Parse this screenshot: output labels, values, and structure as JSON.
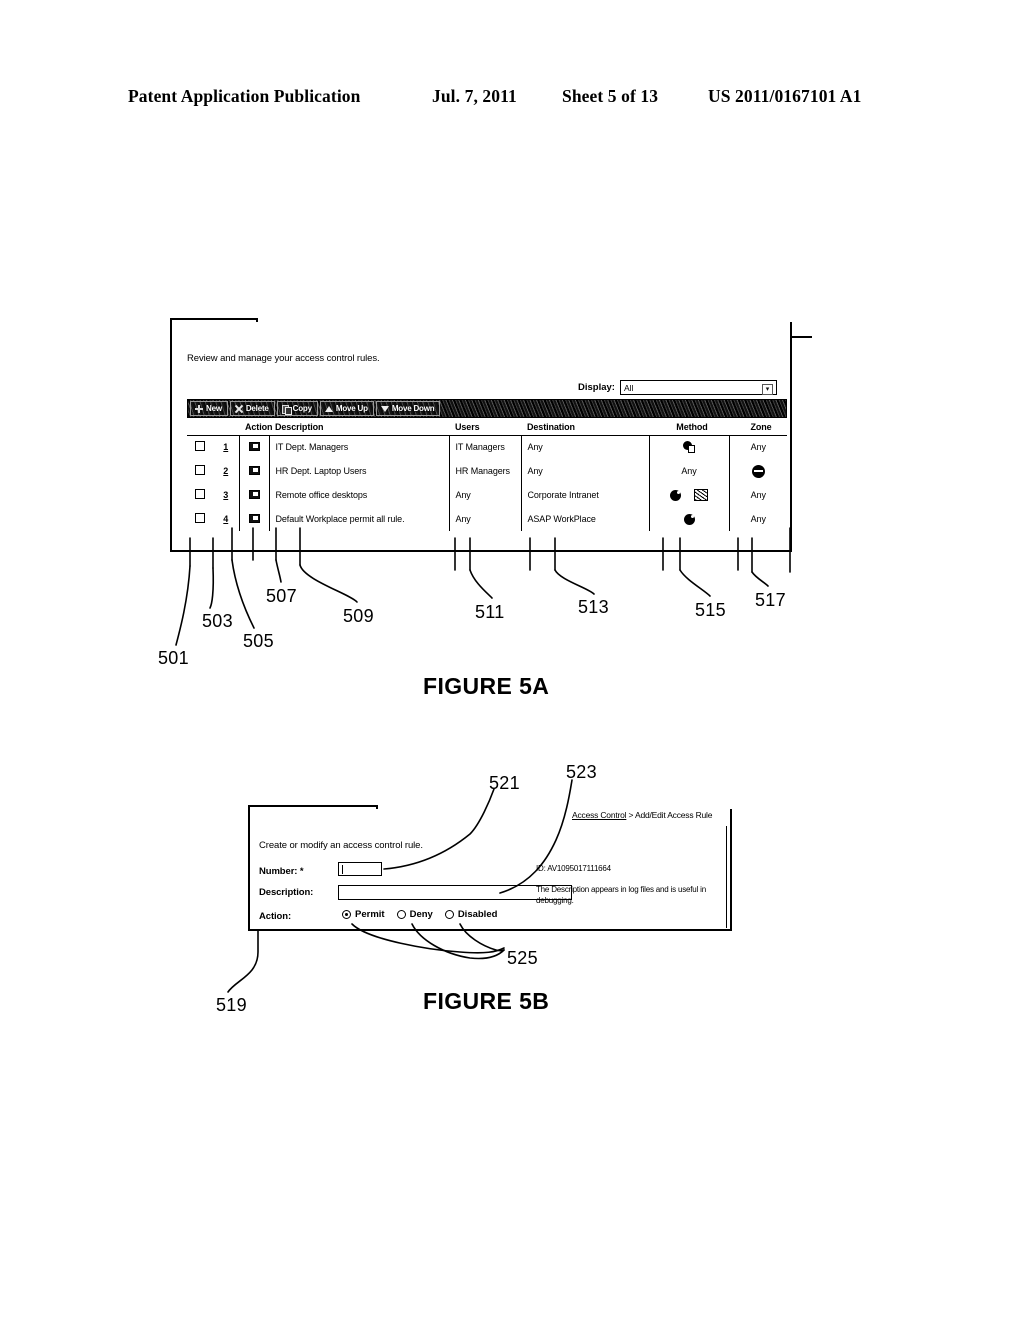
{
  "patent_header": {
    "publication": "Patent Application Publication",
    "date": "Jul. 7, 2011",
    "sheet": "Sheet 5 of 13",
    "number": "US 2011/0167101 A1"
  },
  "figure_5a": {
    "caption": "FIGURE 5A",
    "tab_label": "Access Control",
    "subtitle": "Review and manage your access control rules.",
    "display": {
      "label": "Display:",
      "value": "All",
      "caret_icon": "chevron-down-icon"
    },
    "toolbar": {
      "buttons": [
        {
          "label": "New",
          "icon": "plus-icon"
        },
        {
          "label": "Delete",
          "icon": "x-icon"
        },
        {
          "label": "Copy",
          "icon": "copy-icon"
        },
        {
          "label": "Move Up",
          "icon": "triangle-up-icon"
        },
        {
          "label": "Move Down",
          "icon": "triangle-down-icon"
        }
      ]
    },
    "table": {
      "columns": [
        "",
        "",
        "Action",
        "Description",
        "Users",
        "Destination",
        "Method",
        "Zone"
      ],
      "rows": [
        {
          "checkbox": false,
          "number": "1",
          "action_icon": "rule-flag-icon",
          "description": "IT Dept. Managers",
          "users": "IT Managers",
          "destination": "Any",
          "method_icons": [
            "lock-icon"
          ],
          "method_text": "",
          "zone_text": "Any",
          "zone_icon": ""
        },
        {
          "checkbox": false,
          "number": "2",
          "action_icon": "rule-flag-icon",
          "description": "HR Dept. Laptop Users",
          "users": "HR Managers",
          "destination": "Any",
          "method_icons": [],
          "method_text": "Any",
          "zone_text": "",
          "zone_icon": "no-entry-icon"
        },
        {
          "checkbox": false,
          "number": "3",
          "action_icon": "rule-flag-icon",
          "description": "Remote office desktops",
          "users": "Any",
          "destination": "Corporate Intranet",
          "method_icons": [
            "ball-icon",
            "globe-icon"
          ],
          "method_text": "",
          "zone_text": "Any",
          "zone_icon": ""
        },
        {
          "checkbox": false,
          "number": "4",
          "action_icon": "rule-flag-icon",
          "description": "Default Workplace permit all rule.",
          "users": "Any",
          "destination": "ASAP WorkPlace",
          "method_icons": [
            "ball-icon"
          ],
          "method_text": "",
          "zone_text": "Any",
          "zone_icon": ""
        }
      ]
    },
    "reference_numerals": [
      "501",
      "503",
      "505",
      "507",
      "509",
      "511",
      "513",
      "515",
      "517"
    ]
  },
  "figure_5b": {
    "caption": "FIGURE 5B",
    "tab_label": "Add/Edit Access Rule",
    "subtitle": "Create or modify an access control rule.",
    "breadcrumb": {
      "link": "Access Control",
      "separator": " > ",
      "current": "Add/Edit Access Rule"
    },
    "form": {
      "number_label": "Number: *",
      "number_value": "",
      "description_label": "Description:",
      "description_value": "",
      "action_label": "Action:",
      "radios": [
        {
          "label": "Permit",
          "selected": true
        },
        {
          "label": "Deny",
          "selected": false
        },
        {
          "label": "Disabled",
          "selected": false
        }
      ]
    },
    "info": {
      "id_text": "ID: AV1095017111664",
      "hint_text": "The Description appears in log files and is useful in debugging."
    },
    "reference_numerals": [
      "519",
      "521",
      "523",
      "525"
    ]
  }
}
